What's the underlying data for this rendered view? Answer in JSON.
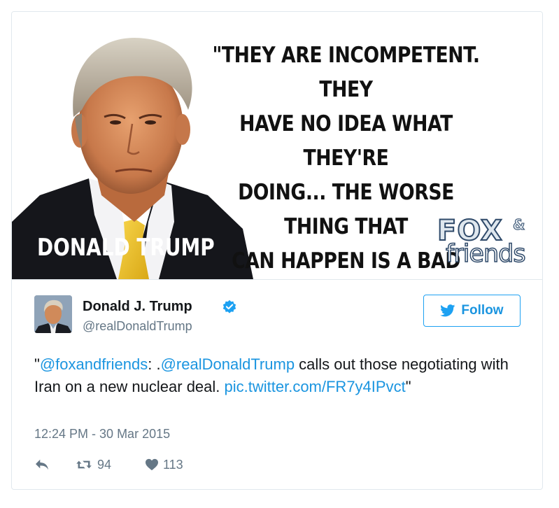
{
  "media": {
    "quote": "\"THEY ARE INCOMPETENT. THEY\nHAVE NO IDEA WHAT THEY'RE\nDOING... THE WORSE THING THAT\nCAN HAPPEN IS A BAD DEAL\nAND THIS IS GOING TO BE\nA BAD DEAL.\"",
    "name_caption": "DONALD TRUMP",
    "logo_fox": "FOX",
    "logo_amp": "&",
    "logo_friends": "friends"
  },
  "author": {
    "name": "Donald J. Trump",
    "handle": "@realDonaldTrump",
    "verified_icon": "verified-badge-icon"
  },
  "follow_button": {
    "label": "Follow",
    "icon": "twitter-bird-icon"
  },
  "tweet": {
    "open_quote": "\"",
    "mention1": "@foxandfriends",
    "sep": ": .",
    "mention2": "@realDonaldTrump",
    "body": " calls out those negotiating with Iran on a new nuclear deal. ",
    "link": "pic.twitter.com/FR7y4IPvct",
    "close_quote": "\""
  },
  "timestamp": "12:24 PM - 30 Mar 2015",
  "actions": {
    "reply_icon": "reply-icon",
    "retweet_icon": "retweet-icon",
    "retweet_count": "94",
    "like_icon": "heart-icon",
    "like_count": "113"
  },
  "colors": {
    "link": "#1b95e0",
    "muted": "#657786",
    "text": "#14171a",
    "border": "#e1e8ed"
  }
}
